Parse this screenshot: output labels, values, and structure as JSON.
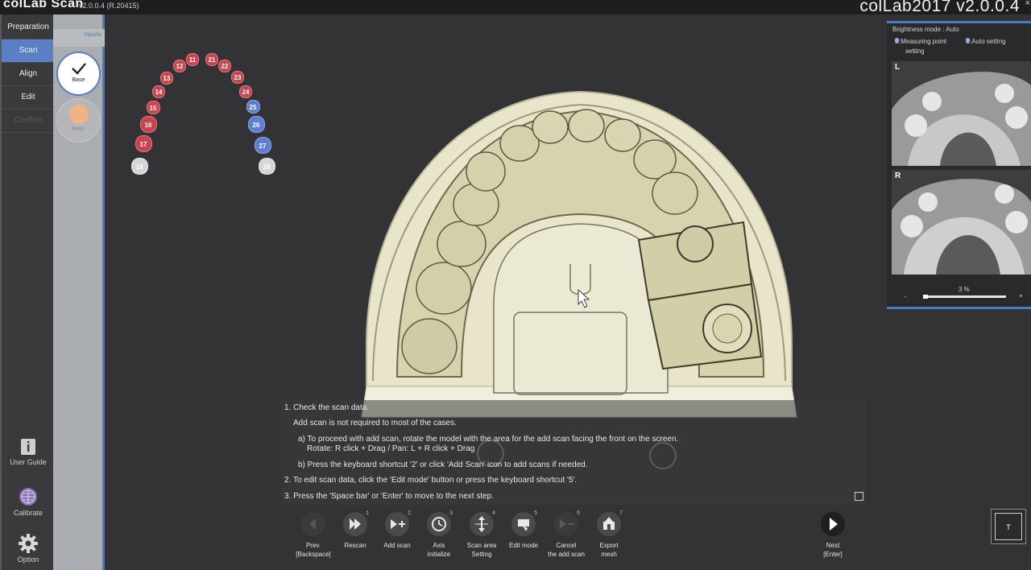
{
  "titlebar": {
    "app_title": "colLab Scan",
    "app_version": "v2.0.0.4 (R.20415)",
    "brand_version": "colLab2017 v2.0.0.4",
    "close": "×"
  },
  "left_menu": {
    "items": [
      {
        "label": "Preparation",
        "state": "normal"
      },
      {
        "label": "Scan",
        "state": "active"
      },
      {
        "label": "Align",
        "state": "normal"
      },
      {
        "label": "Edit",
        "state": "normal"
      },
      {
        "label": "Confirm",
        "state": "disabled"
      }
    ],
    "tools": [
      {
        "label": "User Guide",
        "icon": "info-icon"
      },
      {
        "label": "Calibrate",
        "icon": "grid-sphere-icon"
      },
      {
        "label": "Option",
        "icon": "gear-icon"
      }
    ]
  },
  "sub_panel": {
    "header": "Maxilla",
    "steps": [
      {
        "label": "Base",
        "icon": "checkmark-icon",
        "state": "done"
      },
      {
        "label": "Prep.",
        "icon": "dot-icon",
        "state": "pending"
      }
    ]
  },
  "tooth_chart": {
    "teeth": [
      {
        "n": "11",
        "color": "#c9444f"
      },
      {
        "n": "21",
        "color": "#c9444f"
      },
      {
        "n": "12",
        "color": "#c9444f"
      },
      {
        "n": "22",
        "color": "#c9444f"
      },
      {
        "n": "13",
        "color": "#c9444f"
      },
      {
        "n": "23",
        "color": "#c9444f"
      },
      {
        "n": "14",
        "color": "#c9444f"
      },
      {
        "n": "24",
        "color": "#c9444f"
      },
      {
        "n": "15",
        "color": "#c9444f"
      },
      {
        "n": "25",
        "color": "#5e7fd0"
      },
      {
        "n": "16",
        "color": "#c9444f"
      },
      {
        "n": "26",
        "color": "#5e7fd0"
      },
      {
        "n": "17",
        "color": "#c9444f"
      },
      {
        "n": "27",
        "color": "#5e7fd0"
      },
      {
        "n": "18",
        "color": "#d6d6d6"
      },
      {
        "n": "28",
        "color": "#d6d6d6"
      }
    ]
  },
  "instructions": {
    "lines": [
      "1. Check the scan data.",
      "Add scan is not required to most of the cases.",
      "a) To proceed with add scan, rotate the model with the area for the add scan facing the front on the screen.",
      "Rotate: R click + Drag / Pan: L + R click + Drag",
      "b) Press the keyboard shortcut '2' or click 'Add Scan' icon to add scans if needed.",
      "2. To edit scan data, click the 'Edit mode' button or press the keyboard shortcut '5'.",
      "3. Press the 'Space bar' or 'Enter' to move to the next step."
    ]
  },
  "toolbar": {
    "buttons": [
      {
        "label1": "Prev.",
        "label2": "[Backspace]",
        "num": "",
        "icon": "prev-icon",
        "disabled": true
      },
      {
        "label1": "Rescan",
        "label2": "",
        "num": "1",
        "icon": "rescan-icon",
        "disabled": false
      },
      {
        "label1": "Add scan",
        "label2": "",
        "num": "2",
        "icon": "add-scan-icon",
        "disabled": false
      },
      {
        "label1": "Axis",
        "label2": "initialize",
        "num": "3",
        "icon": "axis-initialize-icon",
        "disabled": false
      },
      {
        "label1": "Scan area",
        "label2": "Setting",
        "num": "4",
        "icon": "scan-area-icon",
        "disabled": false
      },
      {
        "label1": "Edit mode",
        "label2": "",
        "num": "5",
        "icon": "edit-mode-icon",
        "disabled": false
      },
      {
        "label1": "Cancel",
        "label2": "the add scan",
        "num": "6",
        "icon": "cancel-add-scan-icon",
        "disabled": true
      },
      {
        "label1": "Export",
        "label2": "mesh",
        "num": "7",
        "icon": "export-mesh-icon",
        "disabled": false
      }
    ],
    "next": {
      "label1": "Next",
      "label2": "[Enter]",
      "icon": "next-icon"
    }
  },
  "preview_panel": {
    "brightness_mode": "Brightness mode : Auto",
    "measuring_point": ":Measuring point",
    "measuring_point_2": "setting",
    "auto_setting": ":Auto setting",
    "left_tag": "L",
    "right_tag": "R",
    "progress_percent": "3 %",
    "progress_value": 0.03,
    "minus": "-",
    "plus": "+"
  },
  "t_button": {
    "label": "T"
  },
  "colors": {
    "accent": "#4c78c6",
    "tooth_red": "#c9444f",
    "tooth_blue": "#5e7fd0",
    "model": "#e9e6cf"
  }
}
